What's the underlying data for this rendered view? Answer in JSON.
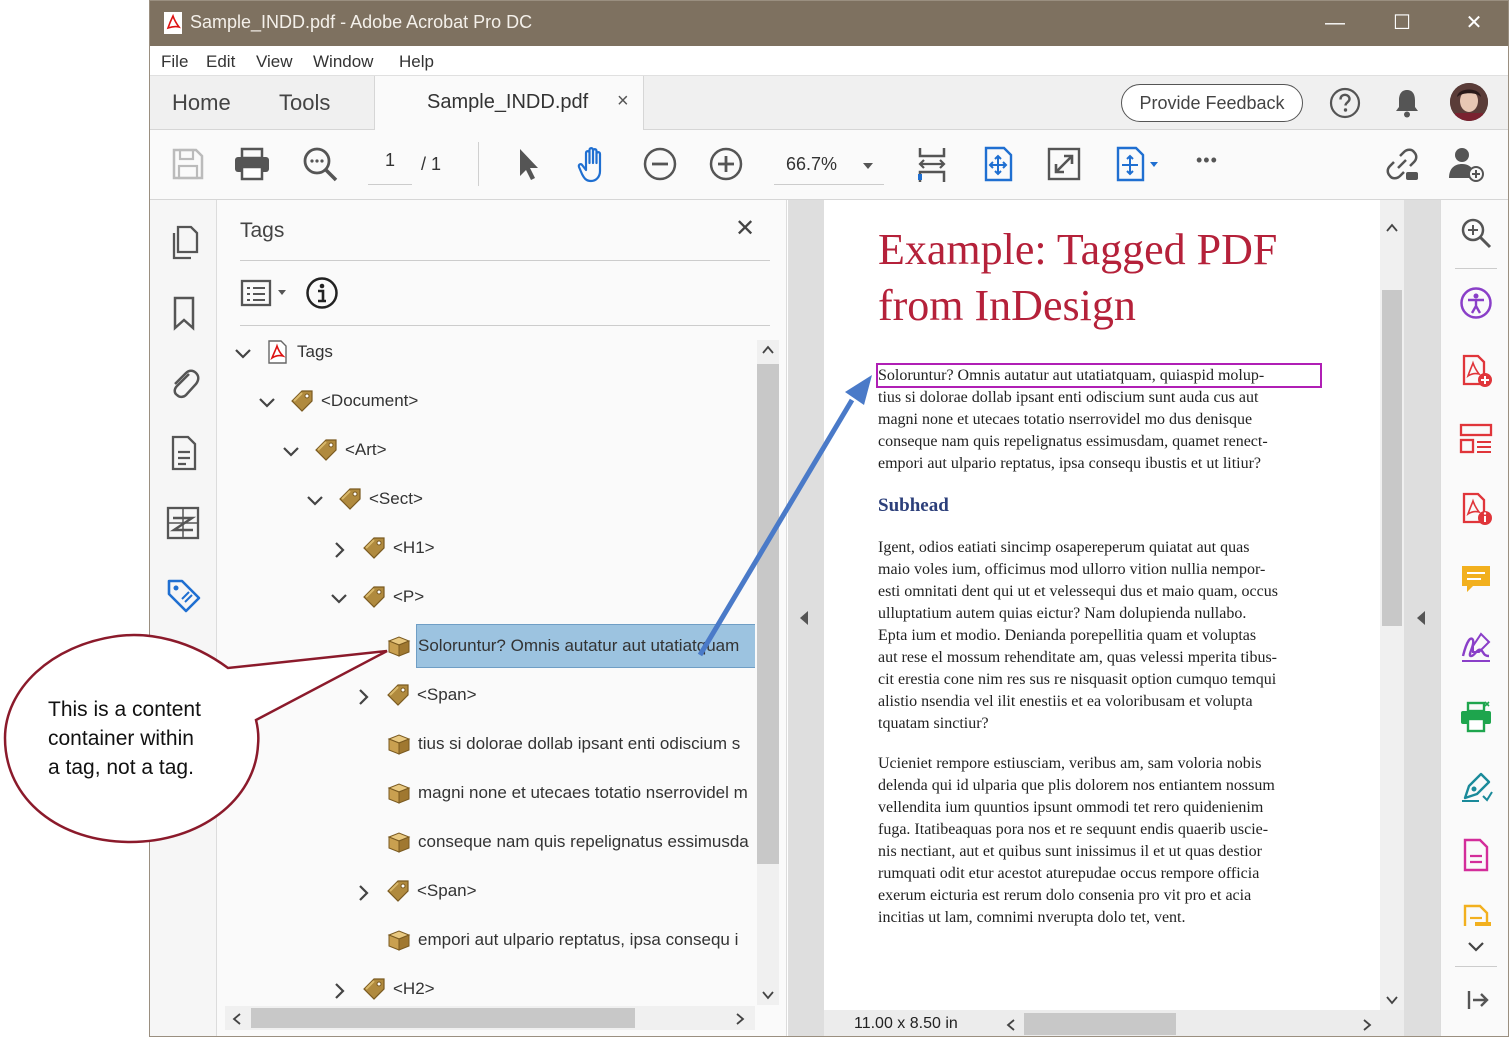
{
  "window": {
    "title": "Sample_INDD.pdf - Adobe Acrobat Pro DC",
    "minimize": "—",
    "maximize": "☐",
    "close": "✕"
  },
  "menu": [
    "File",
    "Edit",
    "View",
    "Window",
    "Help"
  ],
  "tabs": {
    "home": "Home",
    "tools": "Tools",
    "document": "Sample_INDD.pdf",
    "close": "×",
    "feedback": "Provide Feedback"
  },
  "toolbar": {
    "page_current": "1",
    "page_total": "/ 1",
    "zoom": "66.7%",
    "more": "•••"
  },
  "tags_panel": {
    "title": "Tags",
    "close": "✕",
    "tree": [
      {
        "label": "Tags",
        "kind": "root",
        "expander": "open"
      },
      {
        "label": "<Document>",
        "kind": "tag",
        "expander": "open"
      },
      {
        "label": "<Art>",
        "kind": "tag",
        "expander": "open"
      },
      {
        "label": "<Sect>",
        "kind": "tag",
        "expander": "open"
      },
      {
        "label": "<H1>",
        "kind": "tag",
        "expander": "closed"
      },
      {
        "label": "<P>",
        "kind": "tag",
        "expander": "open"
      },
      {
        "label": "Soloruntur? Omnis autatur aut utatiatquam",
        "kind": "content",
        "expander": "none",
        "selected": true
      },
      {
        "label": "<Span>",
        "kind": "tag",
        "expander": "closed"
      },
      {
        "label": "tius si dolorae dollab ipsant enti odiscium s",
        "kind": "content",
        "expander": "none"
      },
      {
        "label": "magni none et utecaes totatio nserrovidel m",
        "kind": "content",
        "expander": "none"
      },
      {
        "label": "conseque nam quis repelignatus essimusda",
        "kind": "content",
        "expander": "none"
      },
      {
        "label": "<Span>",
        "kind": "tag",
        "expander": "closed"
      },
      {
        "label": "empori aut ulpario reptatus, ipsa consequ i",
        "kind": "content",
        "expander": "none"
      },
      {
        "label": "<H2>",
        "kind": "tag",
        "expander": "closed"
      }
    ]
  },
  "document": {
    "title_line1": "Example: Tagged PDF",
    "title_line2": "from InDesign",
    "para1": [
      "Soloruntur? Omnis autatur aut utatiatquam, quiaspid molup-",
      "tius si dolorae dollab ipsant enti odiscium sunt auda cus aut",
      "magni none et utecaes totatio nserrovidel mo dus denisque",
      "conseque nam quis repelignatus essimusdam, quamet renect-",
      "empori aut ulpario reptatus, ipsa consequ ibustis et ut litiur?"
    ],
    "subhead": "Subhead",
    "para2": [
      "Igent, odios eatiati sincimp osapereperum quiatat aut quas",
      "maio voles ium, officimus mod ullorro vition nullia nempor-",
      "esti omnitati dent qui ut et velessequi dus et maio quam, occus",
      "ulluptatium autem quias eictur? Nam dolupienda nullabo.",
      "Epta ium et modio. Denianda porepellitia quam et voluptas",
      "aut rese el mossum rehenditate am, quas velessi mperita tibus-",
      "cit erestia cone nim res sus re nisquasit option cumquo temqui",
      "alistio nsendia vel ilit enestiis et ea voloribusam et volupta",
      "tquatam sinctiur?"
    ],
    "para3": [
      "Ucieniet rempore estiusciam, veribus am, sam voloria nobis",
      "delenda qui id ulparia que plis dolorem nos entiantem nossum",
      "vellendita ium quuntios ipsunt ommodi tet rero quidenienim",
      "fuga. Itatibeaquas pora nos et re sequunt endis quaerib uscie-",
      "nis nectiant, aut et quibus sunt inissimus il et ut quas destior",
      "rumquati odit etur acestot aturepudae occus rempore officia",
      "exerum eicturia est rerum dolo consenia pro vit pro et acia",
      "incitias ut lam, comnimi nverupta dolo tet, vent."
    ],
    "page_size": "11.00 x 8.50 in"
  },
  "callout": {
    "line1": "This is a content",
    "line2": "container within",
    "line3": "a tag, not a tag."
  },
  "colors": {
    "titlebar": "#7e7160",
    "heading": "#b5213a",
    "subhead": "#2c3f7a",
    "selection": "#9cc3e0",
    "highlight_box": "#b01fb5",
    "arrow": "#4a7ac8",
    "callout_border": "#8b1a2b"
  }
}
